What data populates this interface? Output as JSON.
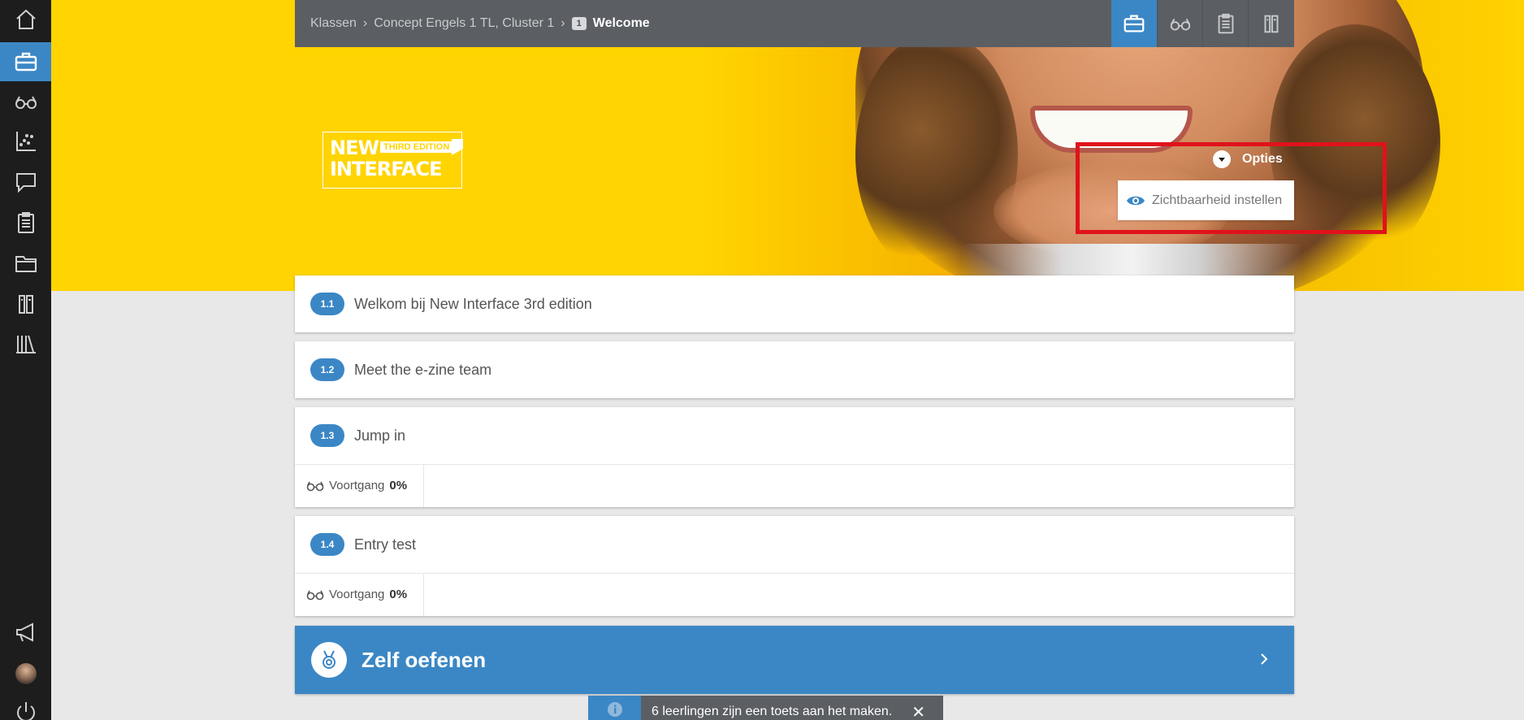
{
  "breadcrumb": {
    "items": [
      "Klassen",
      "Concept Engels 1 TL, Cluster 1"
    ],
    "current_number": "1",
    "current": "Welcome"
  },
  "logo": {
    "line1": "NEW",
    "line2": "INTERFACE",
    "edition": "THIRD EDITION"
  },
  "options": {
    "label": "Opties",
    "menu_item": "Zichtbaarheid instellen"
  },
  "sidebar": {
    "items": [
      "home-icon",
      "briefcase-icon",
      "glasses-icon",
      "chart-icon",
      "chat-icon",
      "clipboard-icon",
      "folder-icon",
      "books-icon",
      "library-icon",
      "megaphone-icon",
      "avatar",
      "power-icon"
    ]
  },
  "lessons": [
    {
      "number": "1.1",
      "title": "Welkom bij New Interface 3rd edition"
    },
    {
      "number": "1.2",
      "title": "Meet the e-zine team"
    },
    {
      "number": "1.3",
      "title": "Jump in",
      "progress_label": "Voortgang",
      "progress_value": "0%"
    },
    {
      "number": "1.4",
      "title": "Entry test",
      "progress_label": "Voortgang",
      "progress_value": "0%"
    }
  ],
  "zelf_oefenen": {
    "label": "Zelf oefenen"
  },
  "toast": {
    "message": "6 leerlingen zijn een toets aan het maken."
  },
  "colors": {
    "accent": "#3b87c5",
    "hero": "#ffd400",
    "sidebar": "#1d1d1d",
    "highlight": "#e0121b"
  }
}
